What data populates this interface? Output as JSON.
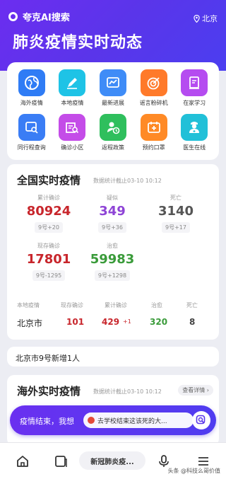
{
  "header": {
    "logo_text": "夸克AI搜索",
    "location": "北京",
    "headline": "肺炎疫情实时动态"
  },
  "quick_grid": [
    {
      "label": "海外疫情",
      "icon": "globe-icon",
      "color": "#2f7cf5"
    },
    {
      "label": "本地疫情",
      "icon": "pen-icon",
      "color": "#1ec3e6"
    },
    {
      "label": "最新进展",
      "icon": "trend-chart-icon",
      "color": "#3f8cf7"
    },
    {
      "label": "谣言粉碎机",
      "icon": "target-icon",
      "color": "#ff7a2a"
    },
    {
      "label": "在家学习",
      "icon": "book-icon",
      "color": "#b54cf0"
    },
    {
      "label": "同行程查询",
      "icon": "ticket-search-icon",
      "color": "#3a7df5"
    },
    {
      "label": "确诊小区",
      "icon": "building-search-icon",
      "color": "#c44ce8"
    },
    {
      "label": "返程政策",
      "icon": "person-clock-icon",
      "color": "#2fbf5d"
    },
    {
      "label": "预约口罩",
      "icon": "calendar-mask-icon",
      "color": "#ff8a26"
    },
    {
      "label": "医生在线",
      "icon": "doctor-icon",
      "color": "#21c0d8"
    }
  ],
  "national": {
    "title": "全国实时疫情",
    "subtitle": "数据统计截止03-10 10:12",
    "stats": [
      {
        "label": "累计确诊",
        "value": "80924",
        "delta": "9号+20",
        "color": "#c8262c"
      },
      {
        "label": "疑似",
        "value": "349",
        "delta": "9号+36",
        "color": "#8e44d6"
      },
      {
        "label": "死亡",
        "value": "3140",
        "delta": "9号+17",
        "color": "#555555"
      },
      {
        "label": "现存确诊",
        "value": "17801",
        "delta": "9号-1295",
        "color": "#c8262c"
      },
      {
        "label": "治愈",
        "value": "59983",
        "delta": "9号+1298",
        "color": "#3a9b3a"
      }
    ],
    "local_headers": [
      "本地疫情",
      "现存确诊",
      "累计确诊",
      "治愈",
      "死亡"
    ],
    "local_row": {
      "city": "北京市",
      "current": "101",
      "total": "429",
      "total_delta": "+1",
      "cured": "320",
      "deaths": "8"
    }
  },
  "news": {
    "text": "北京市9号新增1人"
  },
  "overseas": {
    "title": "海外实时疫情",
    "subtitle": "数据统计截止03-10 10:12",
    "detail_button": "查看详情 ›"
  },
  "ai_bar": {
    "lead": "疫情结束，我想",
    "suggestion": "去学校结束这该死的大..."
  },
  "bottom_nav": {
    "search_label": "新冠肺炎疫...",
    "watermark": "头条 @科技么哥价值"
  },
  "colors": {
    "brand_purple": "#5a35ea",
    "confirmed_red": "#c8262c",
    "cured_green": "#3a9b3a"
  }
}
